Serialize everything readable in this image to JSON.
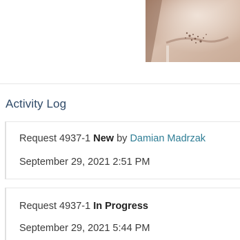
{
  "activity_log": {
    "title": "Activity Log",
    "entries": [
      {
        "request_prefix": "Request 4937-1",
        "status": "New",
        "by_word": "by",
        "user": "Damian Madrzak",
        "timestamp": "September 29, 2021 2:51 PM"
      },
      {
        "request_prefix": "Request 4937-1",
        "status": "In Progress",
        "timestamp": "September 29, 2021 5:44 PM"
      }
    ]
  }
}
